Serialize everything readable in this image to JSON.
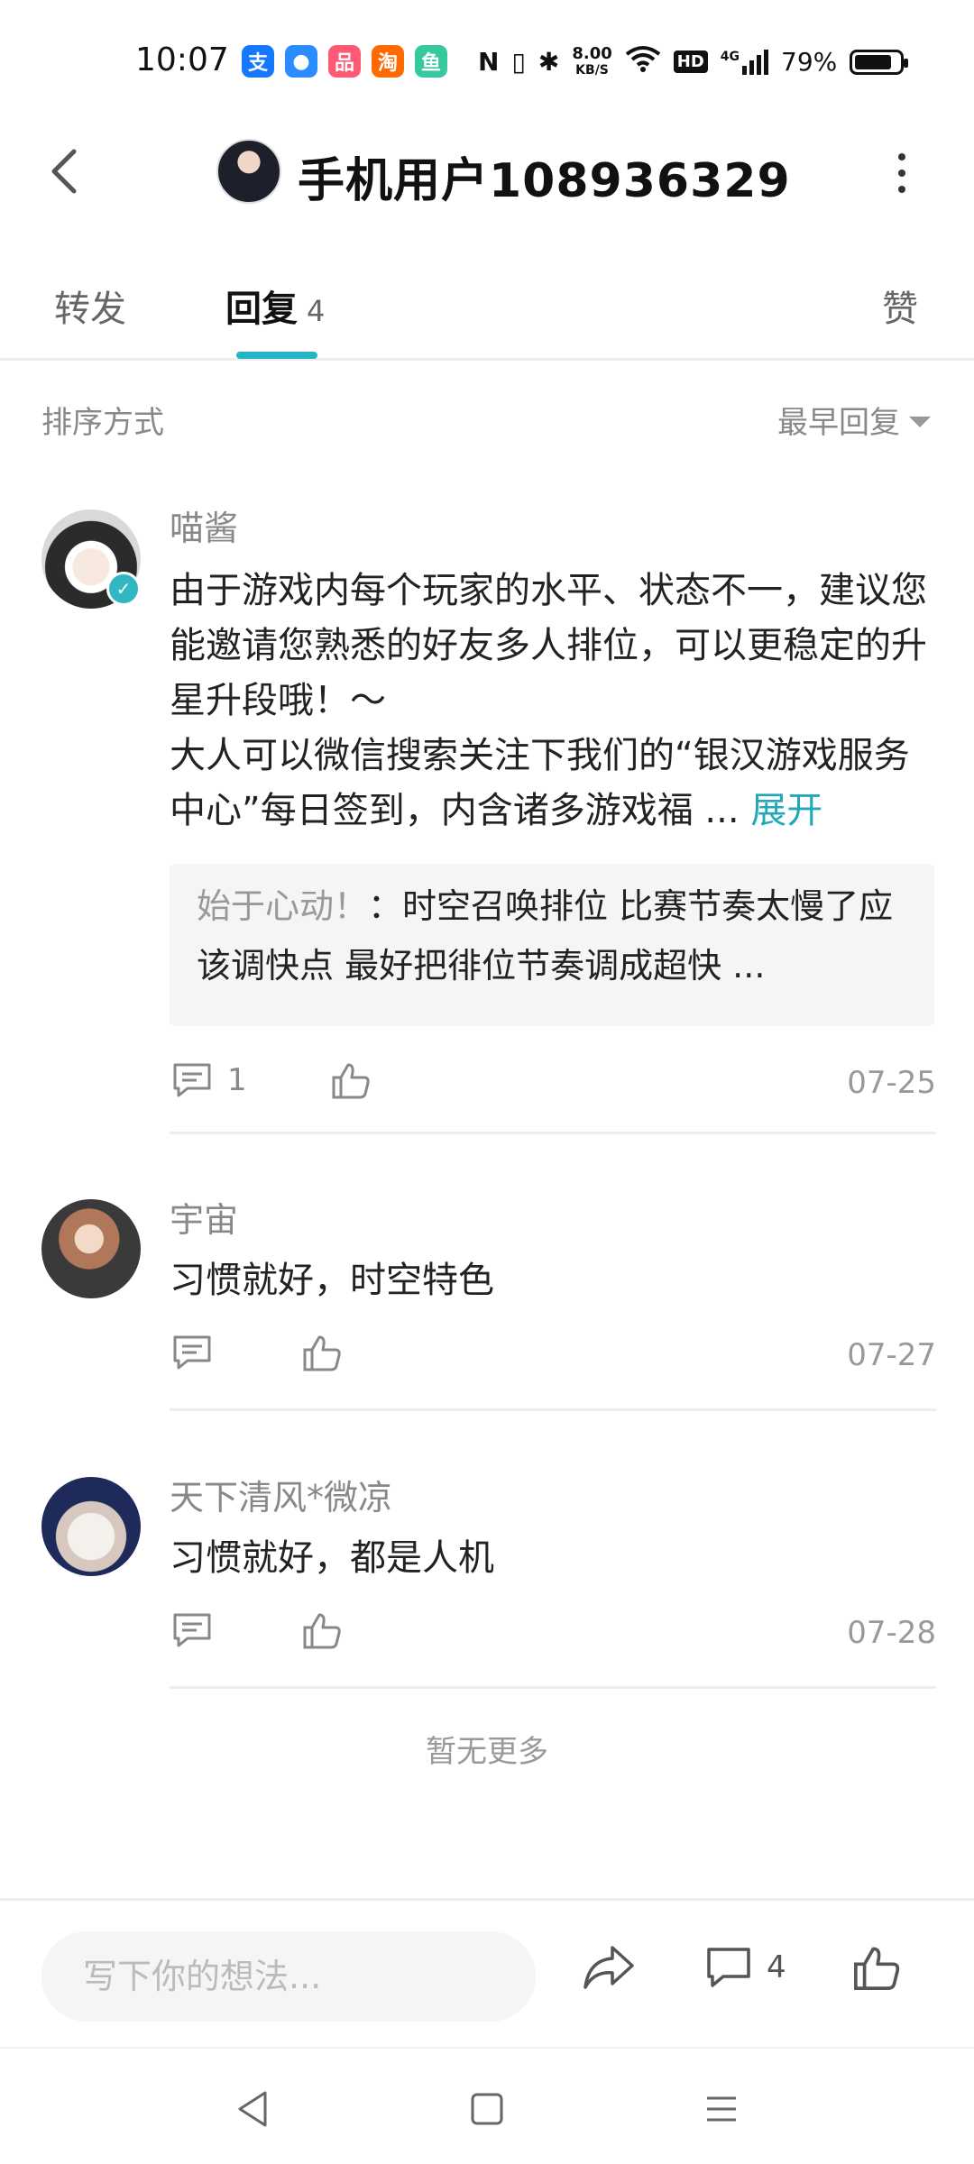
{
  "status_bar": {
    "time": "10:07",
    "net_speed_value": "8.00",
    "net_speed_unit": "KB/S",
    "signal": "4G",
    "battery": "79%",
    "app_icons": [
      {
        "name": "alipay-icon",
        "glyph": "支",
        "color": "#1677ff"
      },
      {
        "name": "circle-app-icon",
        "glyph": "●",
        "color": "#2b8cff"
      },
      {
        "name": "xiaohongshu-icon",
        "glyph": "品",
        "color": "#ff5a74"
      },
      {
        "name": "taobao-icon",
        "glyph": "淘",
        "color": "#ff6a00"
      },
      {
        "name": "fish-app-icon",
        "glyph": "鱼",
        "color": "#35c9a0"
      }
    ]
  },
  "header": {
    "title": "手机用户108936329"
  },
  "tabs": [
    {
      "label": "转发"
    },
    {
      "label": "回复",
      "count": "4"
    },
    {
      "label": "赞"
    }
  ],
  "sort": {
    "label": "排序方式",
    "selected": "最早回复"
  },
  "comments": [
    {
      "author": "喵酱",
      "text": "由于游戏内每个玩家的水平、状态不一，建议您能邀请您熟悉的好友多人排位，可以更稳定的升星升段哦！～\n大人可以微信搜索关注下我们的“银汉游戏服务中心”每日签到，内含诸多游戏福 ...",
      "expand": "展开",
      "quote_author": "始于心动！",
      "quote_text": "：时空召唤排位 比赛节奏太慢了应该调快点 最好把徘位节奏调成超快 ...",
      "reply_count": "1",
      "date": "07-25"
    },
    {
      "author": "宇宙",
      "text": "习惯就好，时空特色",
      "date": "07-27"
    },
    {
      "author": "天下清风*微凉",
      "text": "习惯就好，都是人机",
      "date": "07-28"
    }
  ],
  "no_more": "暂无更多",
  "bottom_bar": {
    "placeholder": "写下你的想法...",
    "comment_count": "4"
  }
}
